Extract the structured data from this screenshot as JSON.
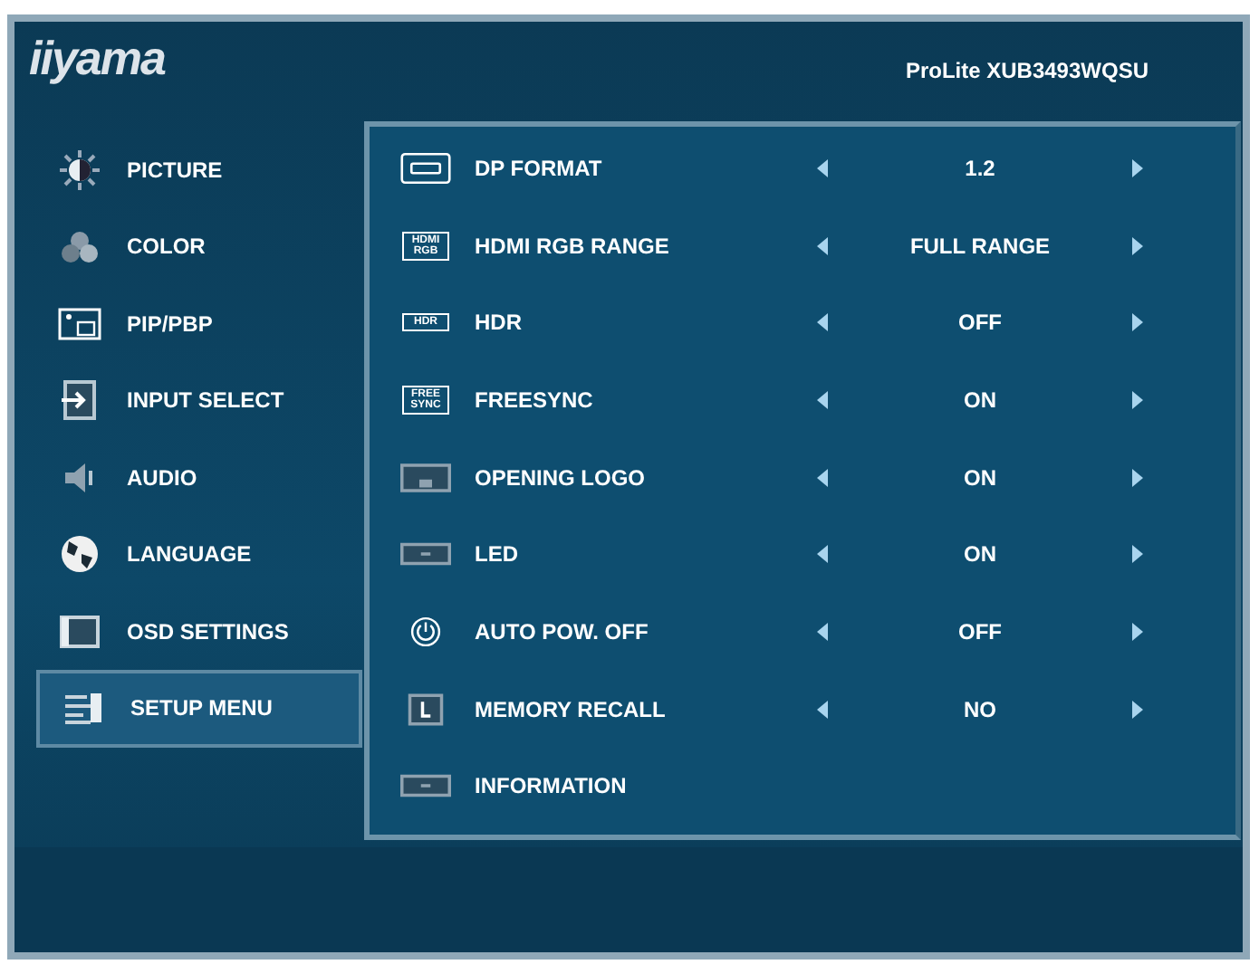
{
  "header": {
    "logo": "iiyama",
    "model": "ProLite XUB3493WQSU"
  },
  "sidebar": {
    "items": [
      {
        "label": "PICTURE",
        "selected": false
      },
      {
        "label": "COLOR",
        "selected": false
      },
      {
        "label": "PIP/PBP",
        "selected": false
      },
      {
        "label": "INPUT SELECT",
        "selected": false
      },
      {
        "label": "AUDIO",
        "selected": false
      },
      {
        "label": "LANGUAGE",
        "selected": false
      },
      {
        "label": "OSD SETTINGS",
        "selected": false
      },
      {
        "label": "SETUP MENU",
        "selected": true
      }
    ]
  },
  "settings": [
    {
      "kind": "option",
      "label": "DP FORMAT",
      "value": "1.2"
    },
    {
      "kind": "option",
      "badge": [
        "HDMI",
        "RGB"
      ],
      "label": "HDMI RGB RANGE",
      "value": "FULL RANGE"
    },
    {
      "kind": "option",
      "badge": [
        "HDR"
      ],
      "label": "HDR",
      "value": "OFF"
    },
    {
      "kind": "option",
      "badge": [
        "FREE",
        "SYNC"
      ],
      "label": "FREESYNC",
      "value": "ON"
    },
    {
      "kind": "option",
      "label": "OPENING LOGO",
      "value": "ON"
    },
    {
      "kind": "option",
      "label": "LED",
      "value": "ON"
    },
    {
      "kind": "option",
      "label": "AUTO POW. OFF",
      "value": "OFF"
    },
    {
      "kind": "option",
      "label": "MEMORY RECALL",
      "value": "NO"
    },
    {
      "kind": "link",
      "label": "INFORMATION"
    }
  ]
}
